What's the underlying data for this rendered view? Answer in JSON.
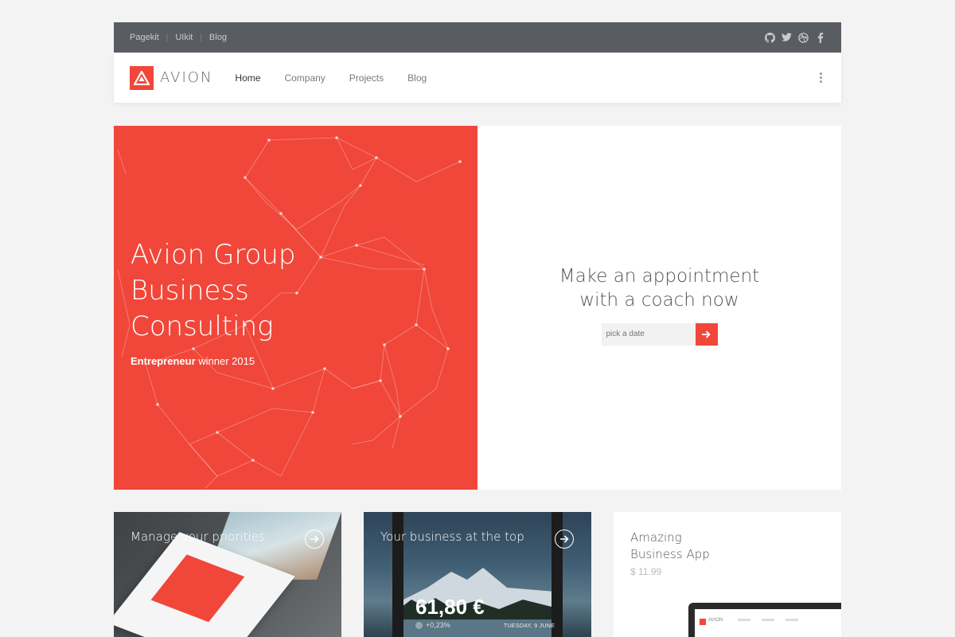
{
  "topbar": {
    "links": [
      "Pagekit",
      "UIkit",
      "Blog"
    ],
    "social_icons": [
      "github-icon",
      "twitter-icon",
      "dribbble-icon",
      "facebook-icon"
    ]
  },
  "navbar": {
    "logo_text": "AVION",
    "items": [
      {
        "label": "Home",
        "active": true
      },
      {
        "label": "Company",
        "active": false
      },
      {
        "label": "Projects",
        "active": false
      },
      {
        "label": "Blog",
        "active": false
      }
    ],
    "menu_icon": "more-vertical-icon"
  },
  "hero": {
    "title_line1": "Avion Group",
    "title_line2": "Business",
    "title_line3": "Consulting",
    "subtitle_bold": "Entrepreneur",
    "subtitle_rest": " winner 2015",
    "appointment_line1": "Make an appointment",
    "appointment_line2": "with a coach now",
    "date_placeholder": "pick a date",
    "submit_icon": "arrow-right-icon"
  },
  "cards": [
    {
      "title": "Manage your priorities",
      "icon": "arrow-right-circle-icon"
    },
    {
      "title": "Your business at the top",
      "icon": "arrow-right-circle-icon",
      "amount": "61,80 €",
      "change": "+0,23%",
      "date": "TUESDAY, 9 JUNE"
    },
    {
      "title_line1": "Amazing",
      "title_line2": "Business App",
      "price": "$ 11.99",
      "device_brand": "AVION"
    }
  ],
  "colors": {
    "accent": "#f0473a",
    "topbar": "#595c61",
    "background": "#f3f3f3"
  }
}
